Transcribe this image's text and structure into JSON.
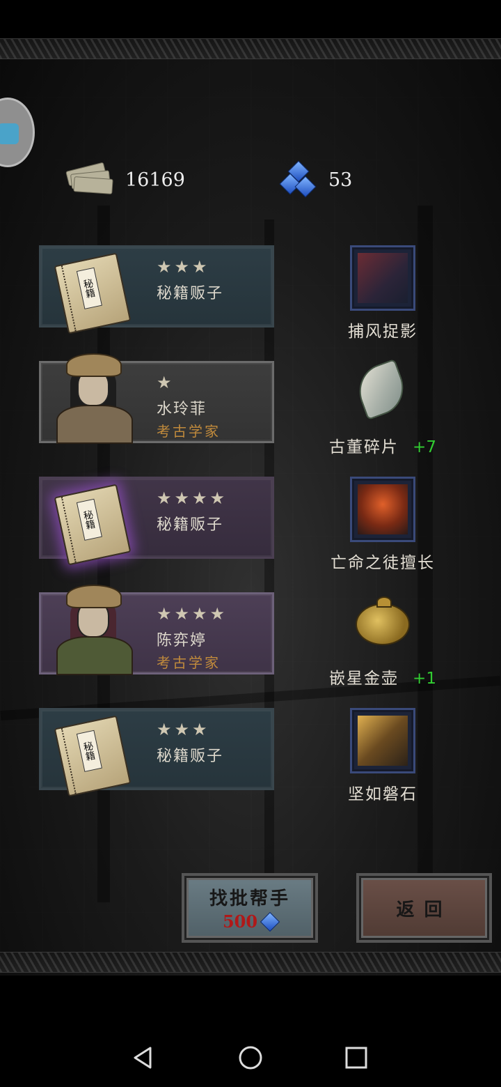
{
  "currency": {
    "money": "16169",
    "gems": "53"
  },
  "recruits": [
    {
      "stars": "★★★",
      "name": "秘籍贩子",
      "class": "",
      "art": "book",
      "book_label": "秘籍",
      "card_style": "teal",
      "reward": {
        "label": "捕风捉影",
        "bonus": "",
        "art": "skill-1"
      }
    },
    {
      "stars": "★",
      "name": "水玲菲",
      "class": "考古学家",
      "art": "hero",
      "card_style": "gray",
      "reward": {
        "label": "古董碎片",
        "bonus": "+7",
        "art": "shard"
      }
    },
    {
      "stars": "★★★★",
      "name": "秘籍贩子",
      "class": "",
      "art": "book",
      "book_label": "秘籍",
      "card_style": "purple",
      "reward": {
        "label": "亡命之徒擅长",
        "bonus": "",
        "art": "skill-2"
      }
    },
    {
      "stars": "★★★★",
      "name": "陈弈婷",
      "class": "考古学家",
      "art": "hero",
      "card_style": "purple2",
      "reward": {
        "label": "嵌星金壶",
        "bonus": "+1",
        "art": "teapot"
      }
    },
    {
      "stars": "★★★",
      "name": "秘籍贩子",
      "class": "",
      "art": "book",
      "book_label": "秘籍",
      "card_style": "teal",
      "reward": {
        "label": "坚如磐石",
        "bonus": "",
        "art": "skill-3"
      }
    }
  ],
  "buttons": {
    "hire_label": "找批帮手",
    "hire_cost": "500",
    "back_label": "返回"
  },
  "colors": {
    "bonus_green": "#32cd32",
    "class_orange": "#c08a3c",
    "cost_red": "#b01818"
  },
  "icons": {
    "money": "money-stack-icon",
    "gems": "blue-gems-icon",
    "nav_back": "triangle-back-icon",
    "nav_home": "circle-home-icon",
    "nav_recent": "square-recent-icon"
  }
}
